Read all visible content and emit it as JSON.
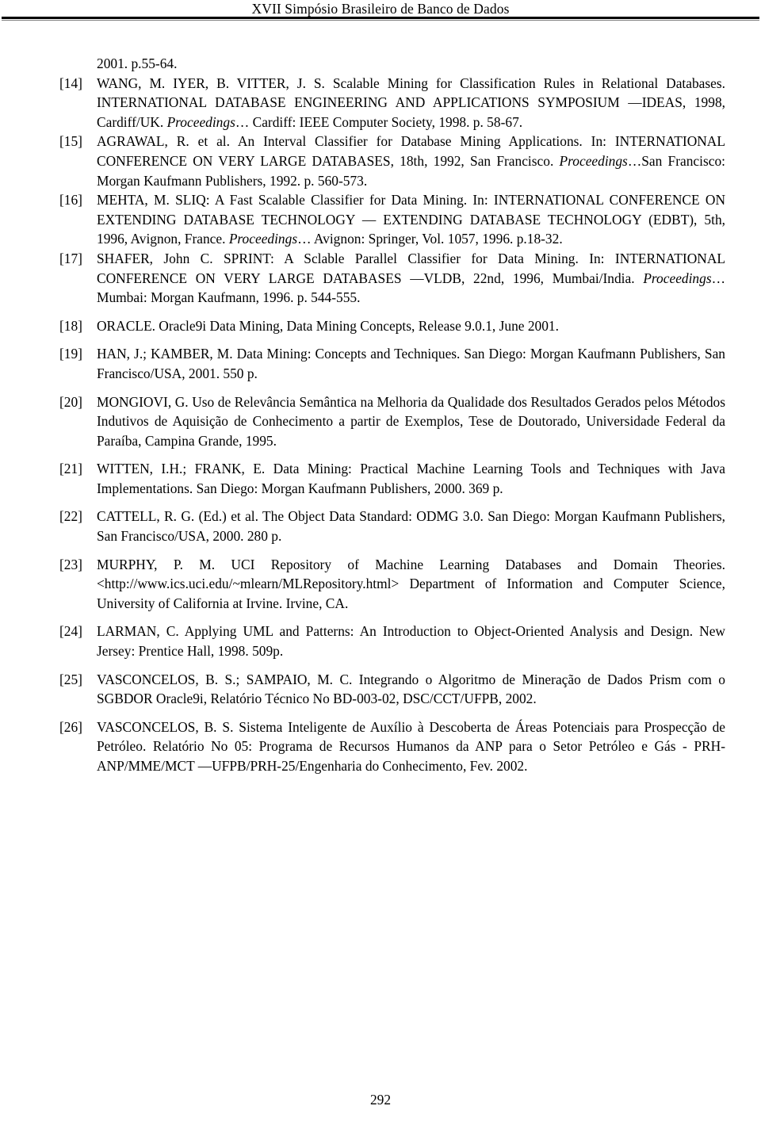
{
  "header": {
    "running_title": "XVII Simpósio Brasileiro de Banco de Dados"
  },
  "body": {
    "continuation_line": "2001. p.55-64.",
    "references": [
      {
        "number": "[14]",
        "text_parts": [
          {
            "style": "roman",
            "text": "WANG, M. IYER, B. VITTER, J. S. Scalable Mining for Classification Rules in Relational Databases. INTERNATIONAL DATABASE ENGINEERING AND APPLICATIONS SYMPOSIUM —IDEAS, 1998, Cardiff/UK. "
          },
          {
            "style": "italic",
            "text": "Proceedings"
          },
          {
            "style": "roman",
            "text": "… Cardiff: IEEE Computer Society, 1998. p. 58-67."
          }
        ],
        "plain": "WANG, M. IYER, B. VITTER, J. S. Scalable Mining for Classification Rules in Relational Databases. INTERNATIONAL DATABASE ENGINEERING AND APPLICATIONS SYMPOSIUM —IDEAS, 1998, Cardiff/UK. Proceedings… Cardiff: IEEE Computer Society, 1998. p. 58-67."
      },
      {
        "number": "[15]",
        "text_parts": [
          {
            "style": "roman",
            "text": "AGRAWAL, R. et al. An Interval Classifier for Database Mining Applications. In: INTERNATIONAL CONFERENCE ON VERY LARGE DATABASES, 18th, 1992, San Francisco. "
          },
          {
            "style": "italic",
            "text": "Proceedings"
          },
          {
            "style": "roman",
            "text": "…San Francisco: Morgan Kaufmann Publishers, 1992. p. 560-573."
          }
        ],
        "plain": "AGRAWAL, R. et al. An Interval Classifier for Database Mining Applications. In: INTERNATIONAL CONFERENCE ON VERY LARGE DATABASES, 18th, 1992, San Francisco. Proceedings…San Francisco: Morgan Kaufmann Publishers, 1992. p. 560-573."
      },
      {
        "number": "[16]",
        "text_parts": [
          {
            "style": "roman",
            "text": "MEHTA, M. SLIQ: A Fast Scalable Classifier for Data Mining. In: INTERNATIONAL CONFERENCE ON EXTENDING DATABASE TECHNOLOGY — EXTENDING DATABASE TECHNOLOGY (EDBT), 5th, 1996, Avignon, France. "
          },
          {
            "style": "italic",
            "text": "Proceedings"
          },
          {
            "style": "roman",
            "text": "… Avignon: Springer, Vol. 1057, 1996. p.18-32."
          }
        ],
        "plain": "MEHTA, M. SLIQ: A Fast Scalable Classifier for Data Mining. In: INTERNATIONAL CONFERENCE ON EXTENDING DATABASE TECHNOLOGY — EXTENDING DATABASE TECHNOLOGY (EDBT), 5th, 1996, Avignon, France. Proceedings… Avignon: Springer, Vol. 1057, 1996. p.18-32."
      },
      {
        "number": "[17]",
        "text_parts": [
          {
            "style": "roman",
            "text": "SHAFER, John C. SPRINT: A Sclable Parallel Classifier for Data Mining. In: INTERNATIONAL CONFERENCE ON VERY LARGE DATABASES —VLDB, 22nd, 1996, Mumbai/India. "
          },
          {
            "style": "italic",
            "text": "Proceedings"
          },
          {
            "style": "roman",
            "text": "…Mumbai: Morgan Kaufmann, 1996. p. 544-555."
          }
        ],
        "plain": "SHAFER, John C. SPRINT: A Sclable Parallel Classifier for Data Mining. In: INTERNATIONAL CONFERENCE ON VERY LARGE DATABASES —VLDB, 22nd, 1996, Mumbai/India. Proceedings…Mumbai: Morgan Kaufmann, 1996. p. 544-555."
      },
      {
        "number": "[18]",
        "text_parts": [
          {
            "style": "roman",
            "text": "ORACLE. Oracle9i Data Mining, Data Mining Concepts, Release 9.0.1, June 2001."
          }
        ],
        "plain": "ORACLE. Oracle9i Data Mining, Data Mining Concepts, Release 9.0.1, June 2001."
      },
      {
        "number": "[19]",
        "text_parts": [
          {
            "style": "roman",
            "text": "HAN, J.; KAMBER, M. Data Mining: Concepts and Techniques. San Diego: Morgan Kaufmann Publishers, San Francisco/USA, 2001. 550 p."
          }
        ],
        "plain": "HAN, J.; KAMBER, M. Data Mining: Concepts and Techniques. San Diego: Morgan Kaufmann Publishers, San Francisco/USA, 2001. 550 p."
      },
      {
        "number": "[20]",
        "text_parts": [
          {
            "style": "roman",
            "text": "MONGIOVI, G. Uso de Relevância Semântica na Melhoria da Qualidade dos Resultados Gerados pelos Métodos Indutivos de Aquisição de Conhecimento a partir de Exemplos, Tese de Doutorado, Universidade Federal da Paraíba, Campina Grande, 1995."
          }
        ],
        "plain": "MONGIOVI, G. Uso de Relevância Semântica na Melhoria da Qualidade dos Resultados Gerados pelos Métodos Indutivos de Aquisição de Conhecimento a partir de Exemplos, Tese de Doutorado, Universidade Federal da Paraíba, Campina Grande, 1995."
      },
      {
        "number": "[21]",
        "text_parts": [
          {
            "style": "roman",
            "text": "WITTEN, I.H.; FRANK, E. Data Mining: Practical Machine Learning Tools and Techniques with Java Implementations. San Diego: Morgan Kaufmann Publishers, 2000. 369 p."
          }
        ],
        "plain": "WITTEN, I.H.; FRANK, E. Data Mining: Practical Machine Learning Tools and Techniques with Java Implementations. San Diego: Morgan Kaufmann Publishers, 2000. 369 p."
      },
      {
        "number": "[22]",
        "text_parts": [
          {
            "style": "roman",
            "text": "CATTELL, R. G. (Ed.) et al. The Object Data Standard: ODMG 3.0. San Diego: Morgan Kaufmann Publishers, San Francisco/USA, 2000. 280 p."
          }
        ],
        "plain": "CATTELL, R. G. (Ed.) et al. The Object Data Standard: ODMG 3.0. San Diego: Morgan Kaufmann Publishers, San Francisco/USA, 2000. 280 p."
      },
      {
        "number": "[23]",
        "text_parts": [
          {
            "style": "roman",
            "text": "MURPHY, P. M. UCI Repository of Machine Learning Databases and Domain Theories. <http://www.ics.uci.edu/~mlearn/MLRepository.html> Department of Information and Computer Science, University of California at Irvine. Irvine, CA."
          }
        ],
        "plain": "MURPHY, P. M. UCI Repository of Machine Learning Databases and Domain Theories. <http://www.ics.uci.edu/~mlearn/MLRepository.html> Department of Information and Computer Science, University of California at Irvine. Irvine, CA."
      },
      {
        "number": "[24]",
        "text_parts": [
          {
            "style": "roman",
            "text": "LARMAN, C. Applying UML and Patterns: An Introduction to Object-Oriented Analysis and Design. New Jersey: Prentice Hall, 1998. 509p."
          }
        ],
        "plain": "LARMAN, C. Applying UML and Patterns: An Introduction to Object-Oriented Analysis and Design. New Jersey: Prentice Hall, 1998. 509p."
      },
      {
        "number": "[25]",
        "text_parts": [
          {
            "style": "roman",
            "text": "VASCONCELOS, B. S.; SAMPAIO, M. C. Integrando o Algoritmo de Mineração de Dados Prism com o SGBDOR Oracle9i, Relatório Técnico No BD-003-02, DSC/CCT/UFPB, 2002."
          }
        ],
        "plain": "VASCONCELOS, B. S.; SAMPAIO, M. C. Integrando o Algoritmo de Mineração de Dados Prism com o SGBDOR Oracle9i, Relatório Técnico No BD-003-02, DSC/CCT/UFPB, 2002."
      },
      {
        "number": "[26]",
        "text_parts": [
          {
            "style": "roman",
            "text": "VASCONCELOS, B. S. Sistema Inteligente de Auxílio à Descoberta de Áreas Potenciais para Prospecção de Petróleo. Relatório No 05: Programa de Recursos Humanos da ANP para o Setor Petróleo e Gás - PRH-ANP/MME/MCT —UFPB/PRH-25/Engenharia do Conhecimento, Fev. 2002."
          }
        ],
        "plain": "VASCONCELOS, B. S. Sistema Inteligente de Auxílio à Descoberta de Áreas Potenciais para Prospecção de Petróleo. Relatório No 05: Programa de Recursos Humanos da ANP para o Setor Petróleo e Gás - PRH-ANP/MME/MCT —UFPB/PRH-25/Engenharia do Conhecimento, Fev. 2002."
      }
    ]
  },
  "footer": {
    "page_number": "292"
  }
}
